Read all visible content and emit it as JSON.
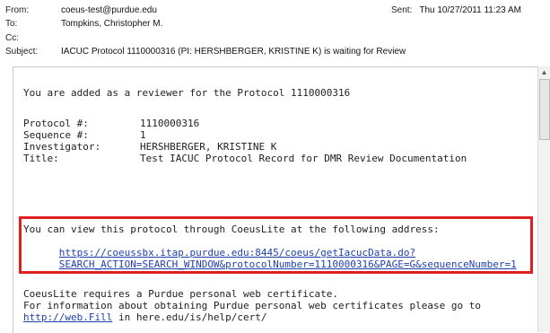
{
  "email": {
    "header": {
      "from_label": "From:",
      "from_value": "coeus-test@purdue.edu",
      "to_label": "To:",
      "to_value": "Tompkins, Christopher M.",
      "cc_label": "Cc:",
      "cc_value": "",
      "subject_label": "Subject:",
      "subject_value": "IACUC Protocol 1110000316 (PI: HERSHBERGER, KRISTINE K) is waiting for Review",
      "sent_label": "Sent:",
      "sent_value": "Thu 10/27/2011 11:23 AM"
    },
    "body": {
      "intro": "You are added as a reviewer for the Protocol 1110000316",
      "fields": [
        {
          "label": "Protocol #:",
          "value": "1110000316"
        },
        {
          "label": "Sequence #:",
          "value": "1"
        },
        {
          "label": "Investigator:",
          "value": "HERSHBERGER, KRISTINE K"
        },
        {
          "label": "Title:",
          "value": "Test IACUC Protocol Record for DMR Review Documentation"
        }
      ],
      "view_text": "You can view this protocol through CoeusLite at the following address:",
      "link_line1": "https://coeussbx.itap.purdue.edu:8445/coeus/getIacucData.do?",
      "link_line2": "SEARCH_ACTION=SEARCH_WINDOW&protocolNumber=1110000316&PAGE=G&sequenceNumber=1",
      "cert_line1": "CoeusLite requires a Purdue personal web certificate.",
      "cert_line2": "For information about obtaining Purdue personal web certificates please go to",
      "cert_link": "http://web.Fill",
      "cert_tail": " in here.edu/is/help/cert/"
    }
  },
  "colors": {
    "highlight_border": "#e02020",
    "link": "#1f3fae"
  }
}
